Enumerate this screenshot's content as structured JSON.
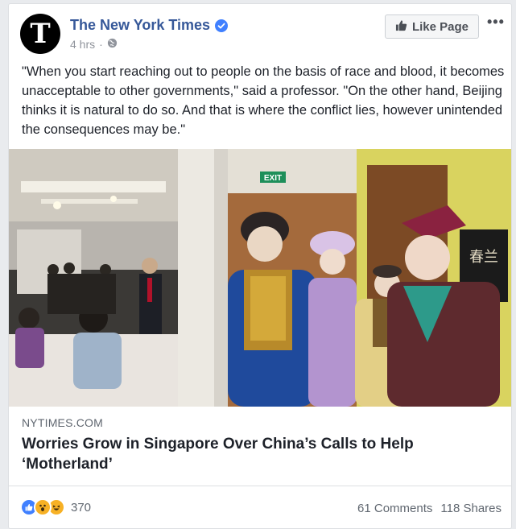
{
  "post": {
    "page_name": "The New York Times",
    "avatar_letter": "T",
    "time": "4 hrs",
    "separator": "·",
    "audience_icon": "globe-icon",
    "like_page_label": "Like Page",
    "more_label": "•••",
    "text": "\"When you start reaching out to people on the basis of race and blood, it becomes unacceptable to other governments,\" said a professor. \"On the other hand, Beijing thinks it is natural to do so. And that is where the conflict lies, however unintended the consequences may be.\""
  },
  "link_preview": {
    "domain": "NYTIMES.COM",
    "headline": "Worries Grow in Singapore Over China’s Calls to Help ‘Motherland’",
    "exit_sign": "EXIT",
    "calligraphy": "春兰"
  },
  "footer": {
    "reaction_icons": [
      "like-icon",
      "wow-icon",
      "haha-icon"
    ],
    "reaction_count": "370",
    "comments": "61 Comments",
    "shares": "118 Shares"
  },
  "colors": {
    "link_blue": "#365899",
    "verified_blue": "#4080ff",
    "muted_text": "#90949c"
  }
}
